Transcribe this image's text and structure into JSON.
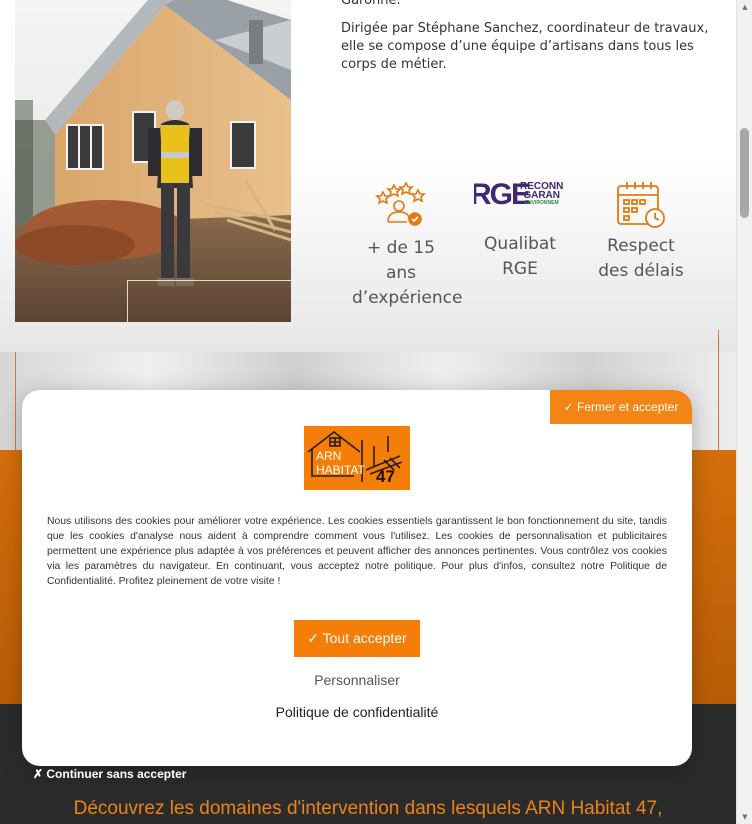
{
  "intro": {
    "partial_line": "Garonne.",
    "paragraph": "Dirigée par Stéphane Sanchez, coordinateur de travaux, elle se compose d’une équipe d’artisans dans tous les corps de métier."
  },
  "features": [
    {
      "icon": "experience-rating-icon",
      "label": "+ de 15 ans d’expérience"
    },
    {
      "icon": "rge-logo",
      "label": "Qualibat RGE",
      "logo_text_big": "RGE",
      "logo_text_small_1": "RECONN",
      "logo_text_small_2": "GARAN",
      "logo_text_tiny": "ENVIRONNEM"
    },
    {
      "icon": "calendar-clock-icon",
      "label": "Respect des délais"
    }
  ],
  "cookie_modal": {
    "close_accept_label": "✓ Fermer et accepter",
    "logo_line1": "ARN",
    "logo_line2": "HABITAT",
    "logo_number": "47",
    "text": "Nous utilisons des cookies pour améliorer votre expérience. Les cookies essentiels garantissent le bon fonctionnement du site, tandis que les cookies d'analyse nous aident à comprendre comment vous l'utilisez. Les cookies de personnalisation et publicitaires permettent une expérience plus adaptée à vos préférences et peuvent afficher des annonces pertinentes. Vous contrôlez vos cookies via les paramètres du navigateur. En continuant, vous acceptez notre politique. Pour plus d'infos, consultez notre Politique de Confidentialité. Profitez pleinement de votre visite !",
    "accept_all_label": "✓ Tout accepter",
    "customize_label": "Personnaliser",
    "privacy_label": "Politique de confidentialité"
  },
  "continue_without_label": "✗ Continuer sans accepter",
  "domains_heading": "Découvrez les domaines d'intervention dans lesquels ARN Habitat 47,",
  "colors": {
    "accent": "#f57e08",
    "accent_dark": "#b85c06",
    "dark_band": "#2b2b2b",
    "heading_orange": "#e8841a"
  }
}
